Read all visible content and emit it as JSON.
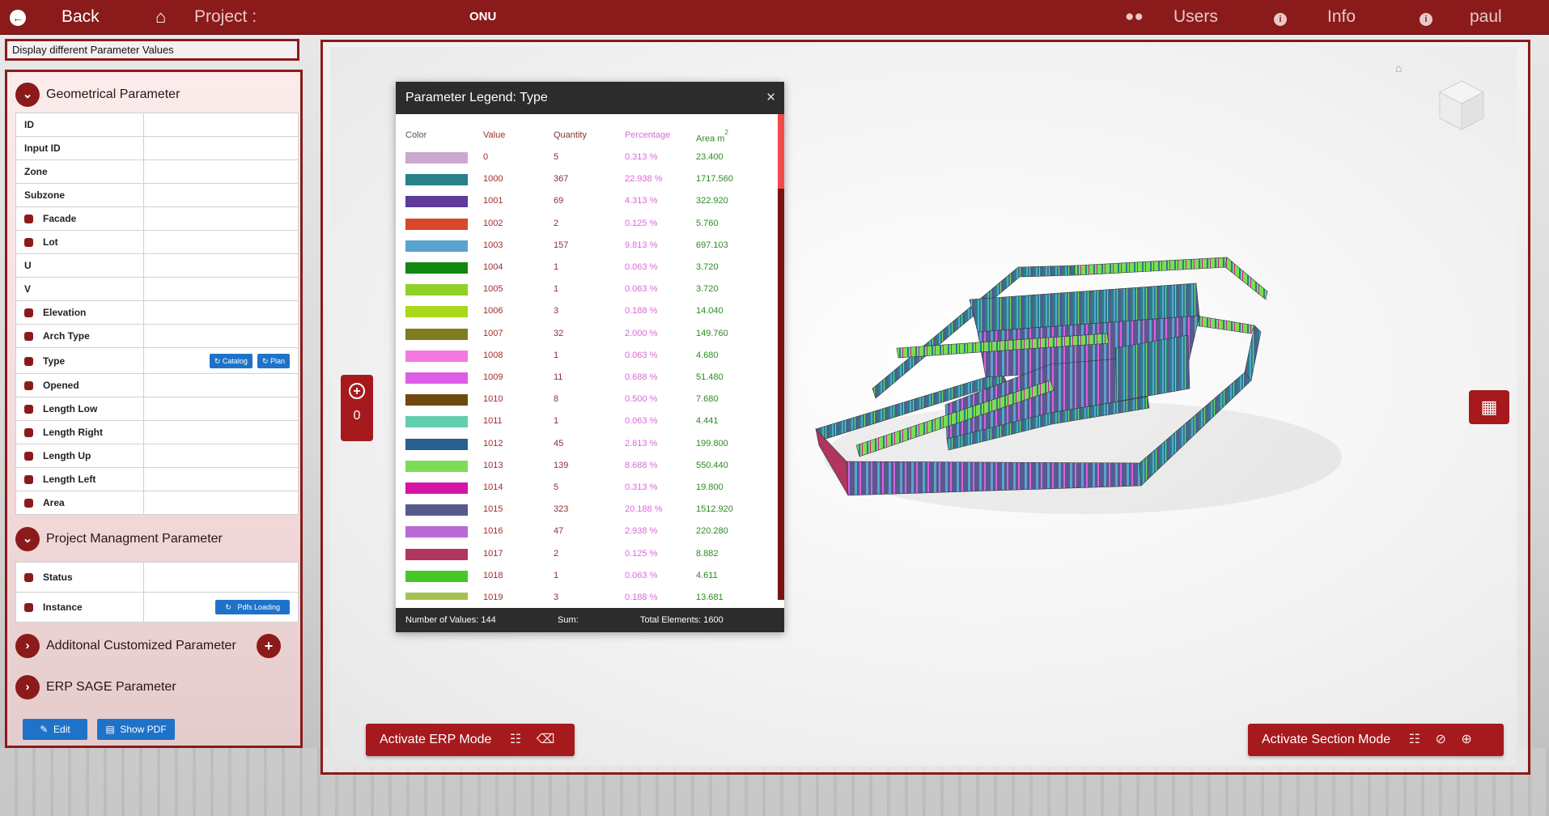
{
  "topbar": {
    "back_label": "Back",
    "project_label": "Project :",
    "project_name": "ONU",
    "users_label": "Users",
    "info_label": "Info",
    "user_name": "paul"
  },
  "left": {
    "display_title": "Display different Parameter Values",
    "geo_section": "Geometrical Parameter",
    "geo_rows": [
      {
        "label": "ID"
      },
      {
        "label": "Input ID"
      },
      {
        "label": "Zone"
      },
      {
        "label": "Subzone"
      },
      {
        "label": "Facade"
      },
      {
        "label": "Lot"
      },
      {
        "label": "U"
      },
      {
        "label": "V"
      },
      {
        "label": "Elevation"
      },
      {
        "label": "Arch Type"
      },
      {
        "label": "Type"
      },
      {
        "label": "Opened"
      },
      {
        "label": "Length Low"
      },
      {
        "label": "Length Right"
      },
      {
        "label": "Length Up"
      },
      {
        "label": "Length Left"
      },
      {
        "label": "Area"
      }
    ],
    "catalog_btn": "Catalog",
    "plan_btn": "Plan",
    "pm_section": "Project Managment Parameter",
    "pm_rows": [
      {
        "label": "Status"
      },
      {
        "label": "Instance"
      }
    ],
    "pdfs_btn": "Pdfs Loading",
    "custom_section": "Additonal Customized Parameter",
    "erp_section": "ERP SAGE Parameter",
    "edit_btn": "Edit",
    "show_pdf_btn": "Show PDF"
  },
  "viewer": {
    "counter_value": "0",
    "erp_mode_btn": "Activate ERP Mode",
    "section_mode_btn": "Activate Section Mode"
  },
  "legend": {
    "title": "Parameter Legend: Type",
    "headers": {
      "color": "Color",
      "value": "Value",
      "quantity": "Quantity",
      "percentage": "Percentage",
      "area": "Area m"
    },
    "area_sup": "2",
    "rows": [
      {
        "color": "#c9a9d0",
        "value": "0",
        "quantity": "5",
        "percentage": "0.313 %",
        "area": "23.400"
      },
      {
        "color": "#27808a",
        "value": "1000",
        "quantity": "367",
        "percentage": "22.938 %",
        "area": "1717.560"
      },
      {
        "color": "#5e3a99",
        "value": "1001",
        "quantity": "69",
        "percentage": "4.313 %",
        "area": "322.920"
      },
      {
        "color": "#d9472b",
        "value": "1002",
        "quantity": "2",
        "percentage": "0.125 %",
        "area": "5.760"
      },
      {
        "color": "#5aa3cf",
        "value": "1003",
        "quantity": "157",
        "percentage": "9.813 %",
        "area": "697.103"
      },
      {
        "color": "#12870f",
        "value": "1004",
        "quantity": "1",
        "percentage": "0.063 %",
        "area": "3.720"
      },
      {
        "color": "#8fd126",
        "value": "1005",
        "quantity": "1",
        "percentage": "0.063 %",
        "area": "3.720"
      },
      {
        "color": "#a7d81a",
        "value": "1006",
        "quantity": "3",
        "percentage": "0.188 %",
        "area": "14.040"
      },
      {
        "color": "#7d7d1f",
        "value": "1007",
        "quantity": "32",
        "percentage": "2.000 %",
        "area": "149.760"
      },
      {
        "color": "#f379e0",
        "value": "1008",
        "quantity": "1",
        "percentage": "0.063 %",
        "area": "4.680"
      },
      {
        "color": "#dd5ee6",
        "value": "1009",
        "quantity": "11",
        "percentage": "0.688 %",
        "area": "51.480"
      },
      {
        "color": "#6e4a10",
        "value": "1010",
        "quantity": "8",
        "percentage": "0.500 %",
        "area": "7.680"
      },
      {
        "color": "#62ceb0",
        "value": "1011",
        "quantity": "1",
        "percentage": "0.063 %",
        "area": "4.441"
      },
      {
        "color": "#275f8f",
        "value": "1012",
        "quantity": "45",
        "percentage": "2.813 %",
        "area": "199.800"
      },
      {
        "color": "#7ddc55",
        "value": "1013",
        "quantity": "139",
        "percentage": "8.688 %",
        "area": "550.440"
      },
      {
        "color": "#d615a7",
        "value": "1014",
        "quantity": "5",
        "percentage": "0.313 %",
        "area": "19.800"
      },
      {
        "color": "#575a8c",
        "value": "1015",
        "quantity": "323",
        "percentage": "20.188 %",
        "area": "1512.920"
      },
      {
        "color": "#b86ad8",
        "value": "1016",
        "quantity": "47",
        "percentage": "2.938 %",
        "area": "220.280"
      },
      {
        "color": "#b03560",
        "value": "1017",
        "quantity": "2",
        "percentage": "0.125 %",
        "area": "8.882"
      },
      {
        "color": "#47c625",
        "value": "1018",
        "quantity": "1",
        "percentage": "0.063 %",
        "area": "4.611"
      },
      {
        "color": "#a6c250",
        "value": "1019",
        "quantity": "3",
        "percentage": "0.188 %",
        "area": "13.681"
      }
    ],
    "footer": {
      "num_values": "Number of Values: 144",
      "sum": "Sum:",
      "total": "Total Elements: 1600"
    }
  }
}
